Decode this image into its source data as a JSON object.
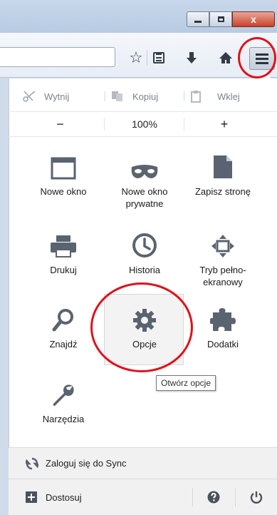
{
  "window": {
    "minimize_glyph": "–",
    "close_glyph": "x"
  },
  "toolbar": {
    "bookmark_star": "☆",
    "bookmarks_list": "bookmarks-list-icon",
    "downloads": "downloads-icon",
    "home": "home-icon",
    "menu": "hamburger-menu-icon"
  },
  "edit": {
    "cut_label": "Wytnij",
    "copy_label": "Kopiuj",
    "paste_label": "Wklej"
  },
  "zoom": {
    "minus": "−",
    "level": "100%",
    "plus": "+"
  },
  "grid": {
    "new_window": "Nowe okno",
    "private_window_line1": "Nowe okno",
    "private_window_line2": "prywatne",
    "save_page": "Zapisz stronę",
    "print": "Drukuj",
    "history": "Historia",
    "fullscreen_line1": "Tryb pełno-",
    "fullscreen_line2": "ekranowy",
    "find": "Znajdź",
    "options": "Opcje",
    "addons": "Dodatki",
    "developer": "Narzędzia"
  },
  "tooltip": "Otwórz opcje",
  "footer": {
    "sync_label": "Zaloguj się do Sync",
    "customize_label": "Dostosuj"
  },
  "colors": {
    "annotation_red": "#e3101b",
    "icon_gray": "#5a6370"
  }
}
